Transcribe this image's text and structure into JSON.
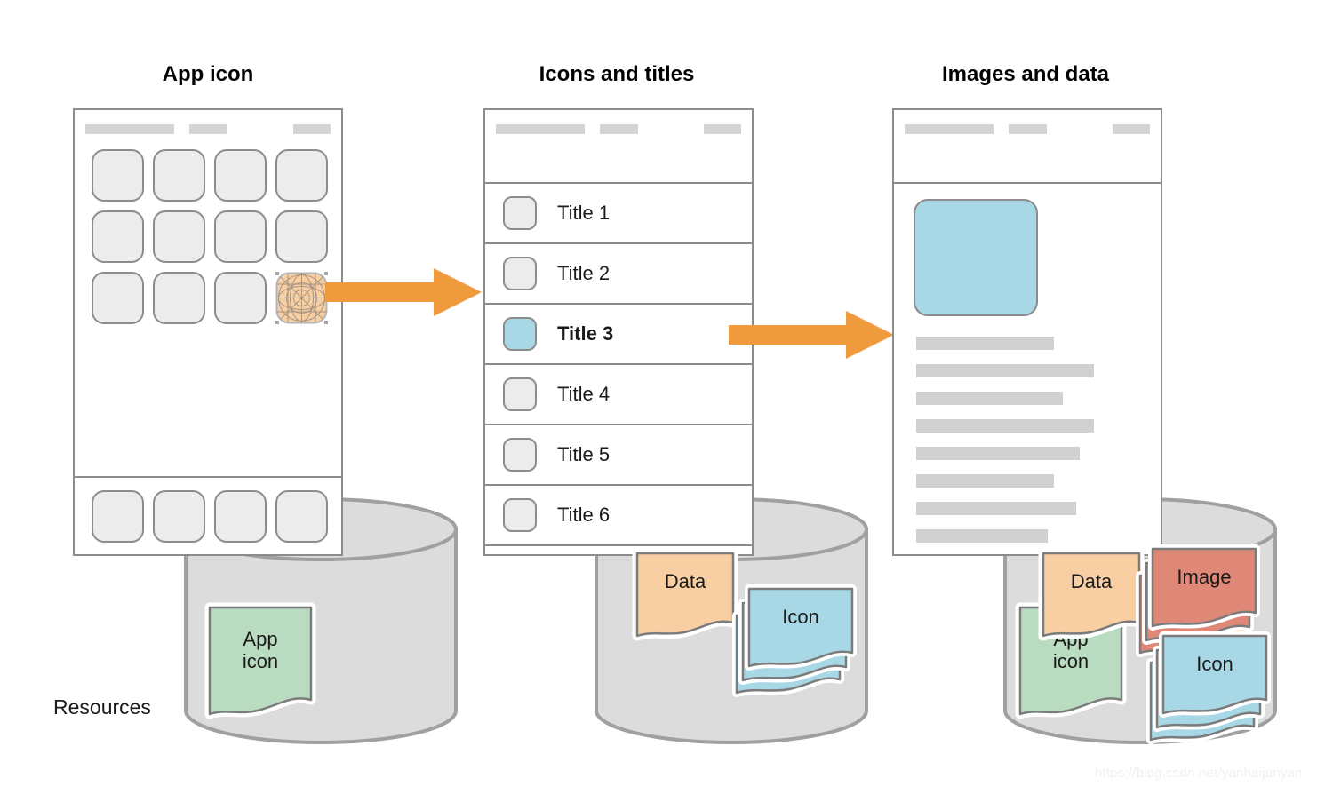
{
  "columns": [
    {
      "title": "App icon"
    },
    {
      "title": "Icons and titles"
    },
    {
      "title": "Images and data"
    }
  ],
  "resources_label": "Resources",
  "watermark": "https://blog.csdn.net/yanhaijunyan",
  "list_panel": {
    "rows": [
      {
        "label": "Title 1",
        "selected": false
      },
      {
        "label": "Title 2",
        "selected": false
      },
      {
        "label": "Title 3",
        "selected": true
      },
      {
        "label": "Title 4",
        "selected": false
      },
      {
        "label": "Title 5",
        "selected": false
      },
      {
        "label": "Title 6",
        "selected": false
      }
    ]
  },
  "detail_panel": {
    "text_line_widths": [
      155,
      200,
      165,
      200,
      184,
      155,
      180,
      148
    ]
  },
  "home_screen": {
    "grid_rows": 3,
    "grid_cols": 4,
    "dock_count": 4,
    "highlighted_index": 11
  },
  "resource_sheets": {
    "app_icon": "App\nicon",
    "app_icon_line1": "App",
    "app_icon_line2": "icon",
    "data": "Data",
    "icon": "Icon",
    "image": "Image"
  },
  "colors": {
    "accent_orange": "#ef9a3d",
    "sheet_green": "#b9dcc0",
    "sheet_orange": "#f7cfa3",
    "sheet_blue": "#a8d8e5",
    "sheet_red": "#e08878",
    "tile_gray": "#ececec",
    "stroke_gray": "#8c8c8c",
    "cylinder_gray": "#dcdcdc",
    "placeholder_gray": "#d1d1d1",
    "hero_blue": "#a8d8e5"
  },
  "cylinders": [
    {
      "name": "resources-cylinder-1"
    },
    {
      "name": "resources-cylinder-2"
    },
    {
      "name": "resources-cylinder-3"
    }
  ],
  "arrows": [
    {
      "name": "arrow-app-icon-to-list"
    },
    {
      "name": "arrow-list-to-detail"
    }
  ]
}
